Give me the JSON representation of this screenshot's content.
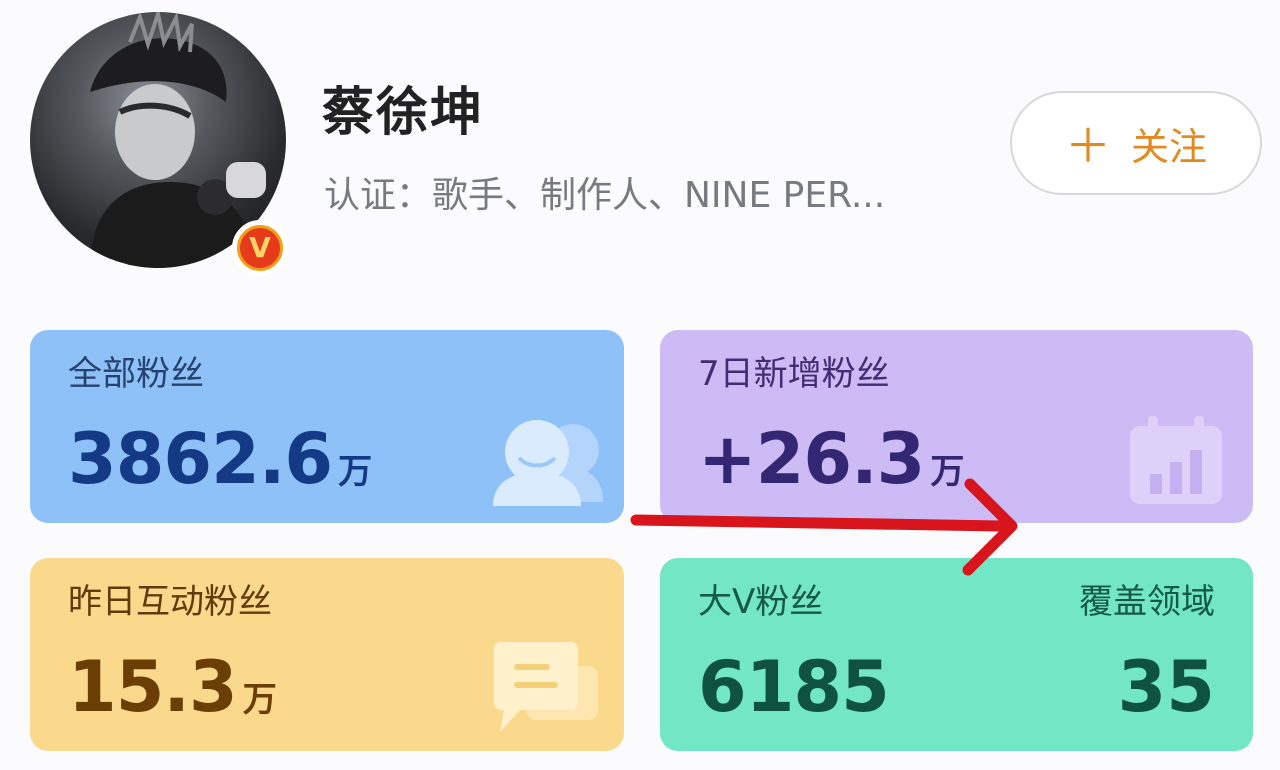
{
  "profile": {
    "name": "蔡徐坤",
    "certification": "认证：歌手、制作人、NINE PER...",
    "badge": "V",
    "follow_button": {
      "icon": "plus-icon",
      "plus": "＋",
      "label": "关注"
    }
  },
  "stats": {
    "all_fans": {
      "label": "全部粉丝",
      "value": "3862.6",
      "unit": "万",
      "icon": "fans-avatar-icon"
    },
    "new_fans_7d": {
      "label": "7日新增粉丝",
      "value": "+26.3",
      "unit": "万",
      "icon": "calendar-chart-icon"
    },
    "interactive_fans": {
      "label": "昨日互动粉丝",
      "value": "15.3",
      "unit": "万",
      "icon": "chat-bubble-icon"
    },
    "big_v_fans": {
      "label": "大V粉丝",
      "value": "6185",
      "right_label": "覆盖领域",
      "right_value": "35"
    }
  },
  "colors": {
    "all_fans_card": "#8ec1f8",
    "new_fans_card": "#cdbbf6",
    "interactive_card": "#fbd98c",
    "big_v_card": "#72e6c5",
    "follow_accent": "#e28a1f",
    "annotation_arrow": "#d8141c"
  },
  "annotation": {
    "type": "arrow",
    "direction": "right"
  }
}
